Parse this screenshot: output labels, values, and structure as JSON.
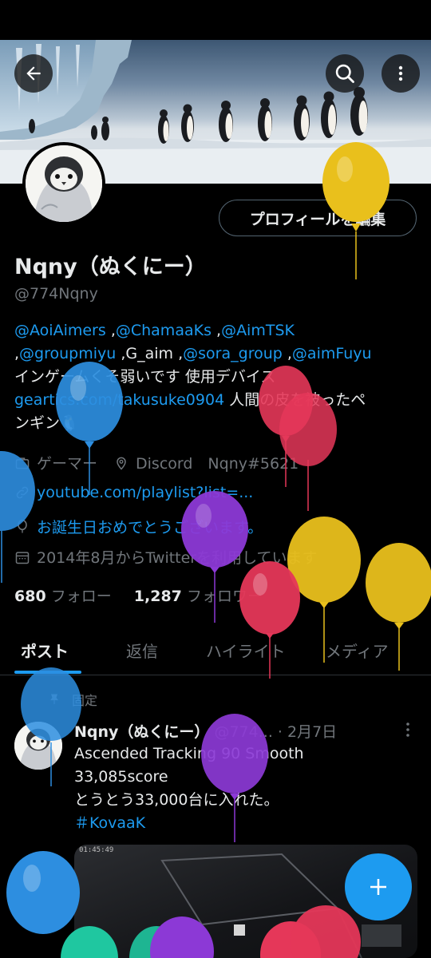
{
  "header": {
    "back_icon": "arrow-left-icon",
    "search_icon": "search-icon",
    "more_icon": "more-vertical-icon"
  },
  "profile": {
    "edit_button_label": "プロフィールを編集",
    "name": "Nqny（ぬくにー）",
    "handle": "@774Nqny",
    "bio": {
      "mentions_line1": [
        "@AoiAimers",
        "@ChamaaKs",
        "@AimTSK"
      ],
      "line2_mention1": "@groupmiyu",
      "line2_plain": "G_aim",
      "line2_mention2": "@sora_group",
      "line2_mention3": "@aimFuyu",
      "line3": "インゲームくそ弱いです 使用デバイス",
      "line4_link": "geartics.com/takusuke0904",
      "line4_text": " 人間の皮を被ったペ",
      "line5": "ンギン🐧"
    },
    "category": "ゲーマー",
    "location": "Discord　Nqny#5621",
    "website": "youtube.com/playlist?list=...",
    "birthday": "お誕生日おめでとうございます。",
    "joined": "2014年8月からTwitterを利用しています",
    "following_count": "680",
    "following_label": "フォロー",
    "followers_count": "1,287",
    "followers_label": "フォロワー"
  },
  "tabs": [
    {
      "label": "ポスト",
      "active": true
    },
    {
      "label": "返信",
      "active": false
    },
    {
      "label": "ハイライト",
      "active": false
    },
    {
      "label": "メディア",
      "active": false
    }
  ],
  "post": {
    "pinned_label": "固定",
    "author_name": "Nqny（ぬくにー）",
    "author_handle": "@774...",
    "date": "· 2月7日",
    "lines": [
      "Ascended Tracking 90 Smooth",
      "33,085score",
      "とうとう33,000台に入れた。"
    ],
    "hashtag": "＃KovaaK",
    "media_timestamp": "01:45:49"
  },
  "fab_icon": "plus-icon",
  "colors": {
    "accent": "#1d9bf0",
    "text": "#e7e9ea",
    "muted": "#71767b",
    "balloon_yellow": "#e9c01c",
    "balloon_blue": "#2d8ee0",
    "balloon_red": "#e53759",
    "balloon_purple": "#8c39d6",
    "balloon_teal": "#1fc7a0"
  }
}
